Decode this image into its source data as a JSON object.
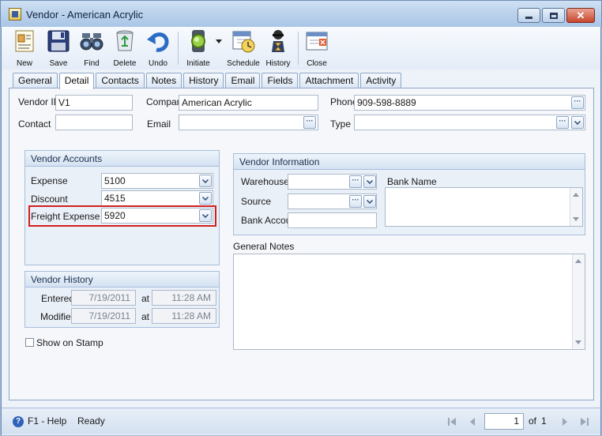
{
  "window": {
    "title": "Vendor - American Acrylic"
  },
  "toolbar": {
    "new": "New",
    "save": "Save",
    "find": "Find",
    "delete": "Delete",
    "undo": "Undo",
    "initiate": "Initiate",
    "schedule": "Schedule",
    "history": "History",
    "close": "Close"
  },
  "tabs": [
    "General",
    "Detail",
    "Contacts",
    "Notes",
    "History",
    "Email",
    "Fields",
    "Attachment",
    "Activity"
  ],
  "active_tab": "Detail",
  "header": {
    "vendor_id_label": "Vendor ID",
    "vendor_id_value": "V1",
    "company_label": "Company",
    "company_value": "American Acrylic",
    "phone_label": "Phone",
    "phone_value": "909-598-8889",
    "contact_label": "Contact",
    "contact_value": "",
    "email_label": "Email",
    "email_value": "",
    "type_label": "Type",
    "type_value": "",
    "ellipsis": "···"
  },
  "vendor_accounts": {
    "title": "Vendor Accounts",
    "expense_label": "Expense",
    "expense_value": "5100",
    "discount_label": "Discount",
    "discount_value": "4515",
    "freight_label": "Freight Expense",
    "freight_value": "5920"
  },
  "vendor_history": {
    "title": "Vendor History",
    "entered_label": "Entered",
    "entered_date": "7/19/2011",
    "entered_time": "11:28 AM",
    "modified_label": "Modified",
    "modified_date": "7/19/2011",
    "modified_time": "11:28 AM",
    "at_label": "at"
  },
  "show_on_stamp": {
    "label": "Show on Stamp",
    "checked": false
  },
  "vendor_information": {
    "title": "Vendor Information",
    "warehouse_label": "Warehouse",
    "source_label": "Source",
    "bank_account_label": "Bank Accou",
    "bank_name_label": "Bank Name"
  },
  "general_notes": {
    "label": "General Notes",
    "value": ""
  },
  "statusbar": {
    "help": "F1 - Help",
    "status": "Ready",
    "page": "1",
    "of_label": "of",
    "total_pages": "1"
  },
  "colors": {
    "highlight": "#d11f1f",
    "accent": "#2d62b8"
  }
}
